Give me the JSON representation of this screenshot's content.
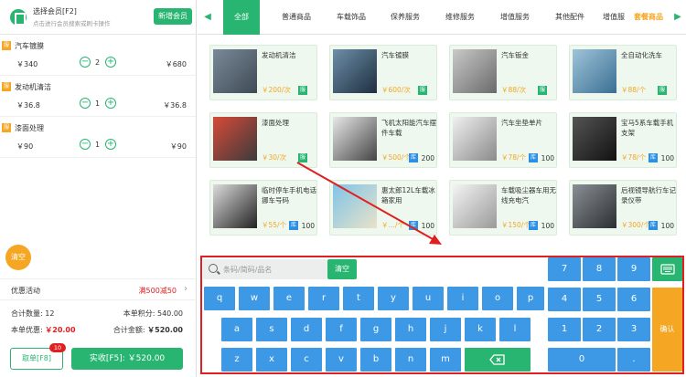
{
  "member": {
    "title": "选择会员[F2]",
    "subtitle": "点击进行会员搜索或刷卡操作",
    "add_label": "新增会员"
  },
  "cart": [
    {
      "tag": "服",
      "name": "汽车镀膜",
      "price": "￥340",
      "qty": "2",
      "sum": "￥680"
    },
    {
      "tag": "服",
      "name": "发动机清洁",
      "price": "￥36.8",
      "qty": "1",
      "sum": "￥36.8"
    },
    {
      "tag": "服",
      "name": "漆面处理",
      "price": "￥90",
      "qty": "1",
      "sum": "￥90"
    }
  ],
  "cart_clear": "清空",
  "promo": {
    "label": "优惠活动",
    "value": "满500减50"
  },
  "summary": {
    "count_label": "合计数量:",
    "count": "12",
    "points_label": "本单积分:",
    "points": "540.00",
    "discount_label": "本单优惠:",
    "discount": "￥20.00",
    "total_label": "合计金额:",
    "total": "￥520.00"
  },
  "actions": {
    "hold": "取单[F8]",
    "hold_badge": "10",
    "pay": "实收[F5]: ￥520.00"
  },
  "tabs": [
    "全部",
    "普通商品",
    "车载饰品",
    "保养服务",
    "维修服务",
    "增值服务",
    "其他配件",
    "增值服",
    "套餐商品"
  ],
  "products": [
    {
      "name": "发动机清洁",
      "price": "￥200/次",
      "badge": "服",
      "stock": ""
    },
    {
      "name": "汽车镀膜",
      "price": "￥600/次",
      "badge": "服",
      "stock": ""
    },
    {
      "name": "汽车钣金",
      "price": "￥88/次",
      "badge": "服",
      "stock": ""
    },
    {
      "name": "全自动化洗车",
      "price": "￥88/个",
      "badge": "服",
      "stock": ""
    },
    {
      "name": "漆面处理",
      "price": "￥30/次",
      "badge": "服",
      "stock": ""
    },
    {
      "name": "飞机太阳能汽车摆件车载",
      "price": "￥500/个",
      "badge": "库",
      "stock": "200"
    },
    {
      "name": "汽车坐垫单片",
      "price": "￥78/个",
      "badge": "库",
      "stock": "100"
    },
    {
      "name": "宝马5系车载手机支架",
      "price": "￥78/个",
      "badge": "库",
      "stock": "100"
    },
    {
      "name": "临时停车手机电话挪车号码",
      "price": "￥55/个",
      "badge": "库",
      "stock": "100"
    },
    {
      "name": "惠太郎12L车载冰箱家用",
      "price": "￥…/个",
      "badge": "库",
      "stock": "100"
    },
    {
      "name": "车载吸尘器车用无线充电汽",
      "price": "￥150/个",
      "badge": "库",
      "stock": "100"
    },
    {
      "name": "后视镜导航行车记录仪带",
      "price": "￥300/个",
      "badge": "库",
      "stock": "100"
    }
  ],
  "keyboard": {
    "placeholder": "条码/简码/品名",
    "clear": "清空",
    "row1": [
      "q",
      "w",
      "e",
      "r",
      "t",
      "y",
      "u",
      "i",
      "o",
      "p"
    ],
    "row2": [
      "a",
      "s",
      "d",
      "f",
      "g",
      "h",
      "j",
      "k",
      "l"
    ],
    "row3": [
      "z",
      "x",
      "c",
      "v",
      "b",
      "n",
      "m"
    ],
    "numpad": [
      "7",
      "8",
      "9",
      "4",
      "5",
      "6",
      "1",
      "2",
      "3",
      "0",
      "."
    ],
    "confirm": "确认"
  }
}
